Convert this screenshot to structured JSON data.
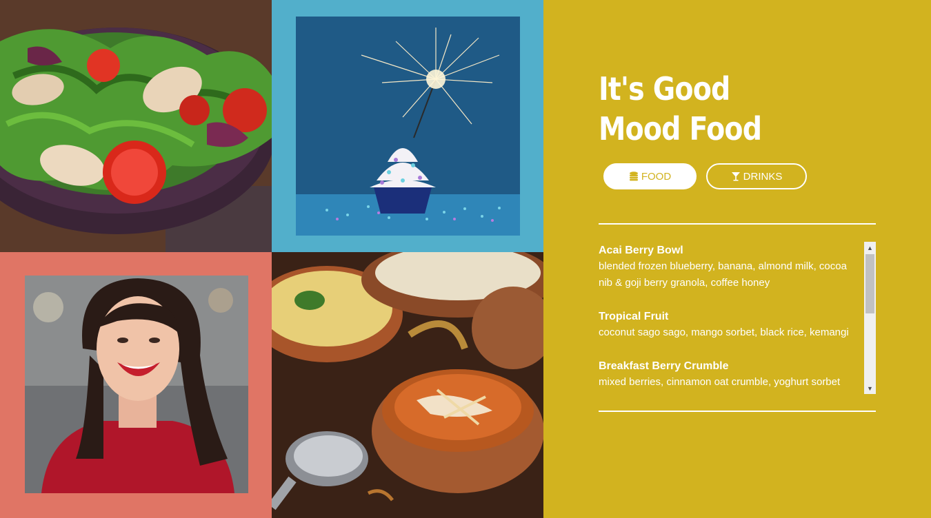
{
  "colors": {
    "menu_panel": "#d2b31f",
    "cupcake_frame": "#52afcb",
    "portrait_frame": "#e07565",
    "cupcake_backdrop": "#1f5a86",
    "text": "#ffffff"
  },
  "photos": {
    "salad": "salad-photo",
    "cupcake": "sparkler-cupcake-photo",
    "portrait": "smiling-woman-photo",
    "curry": "indian-curry-photo"
  },
  "menu": {
    "title_line1": "It's Good",
    "title_line2": "Mood Food",
    "tabs": [
      {
        "label": "FOOD",
        "icon": "coins-stack-icon",
        "active": true
      },
      {
        "label": "DRINKS",
        "icon": "cocktail-glass-icon",
        "active": false
      }
    ],
    "items": [
      {
        "name": "Acai Berry Bowl",
        "description": "blended frozen blueberry, banana, almond milk, cocoa nib & goji berry granola, coffee honey"
      },
      {
        "name": "Tropical Fruit",
        "description": "coconut sago sago, mango sorbet, black rice, kemangi"
      },
      {
        "name": "Breakfast Berry Crumble",
        "description": "mixed berries, cinnamon oat crumble, yoghurt sorbet"
      }
    ]
  }
}
